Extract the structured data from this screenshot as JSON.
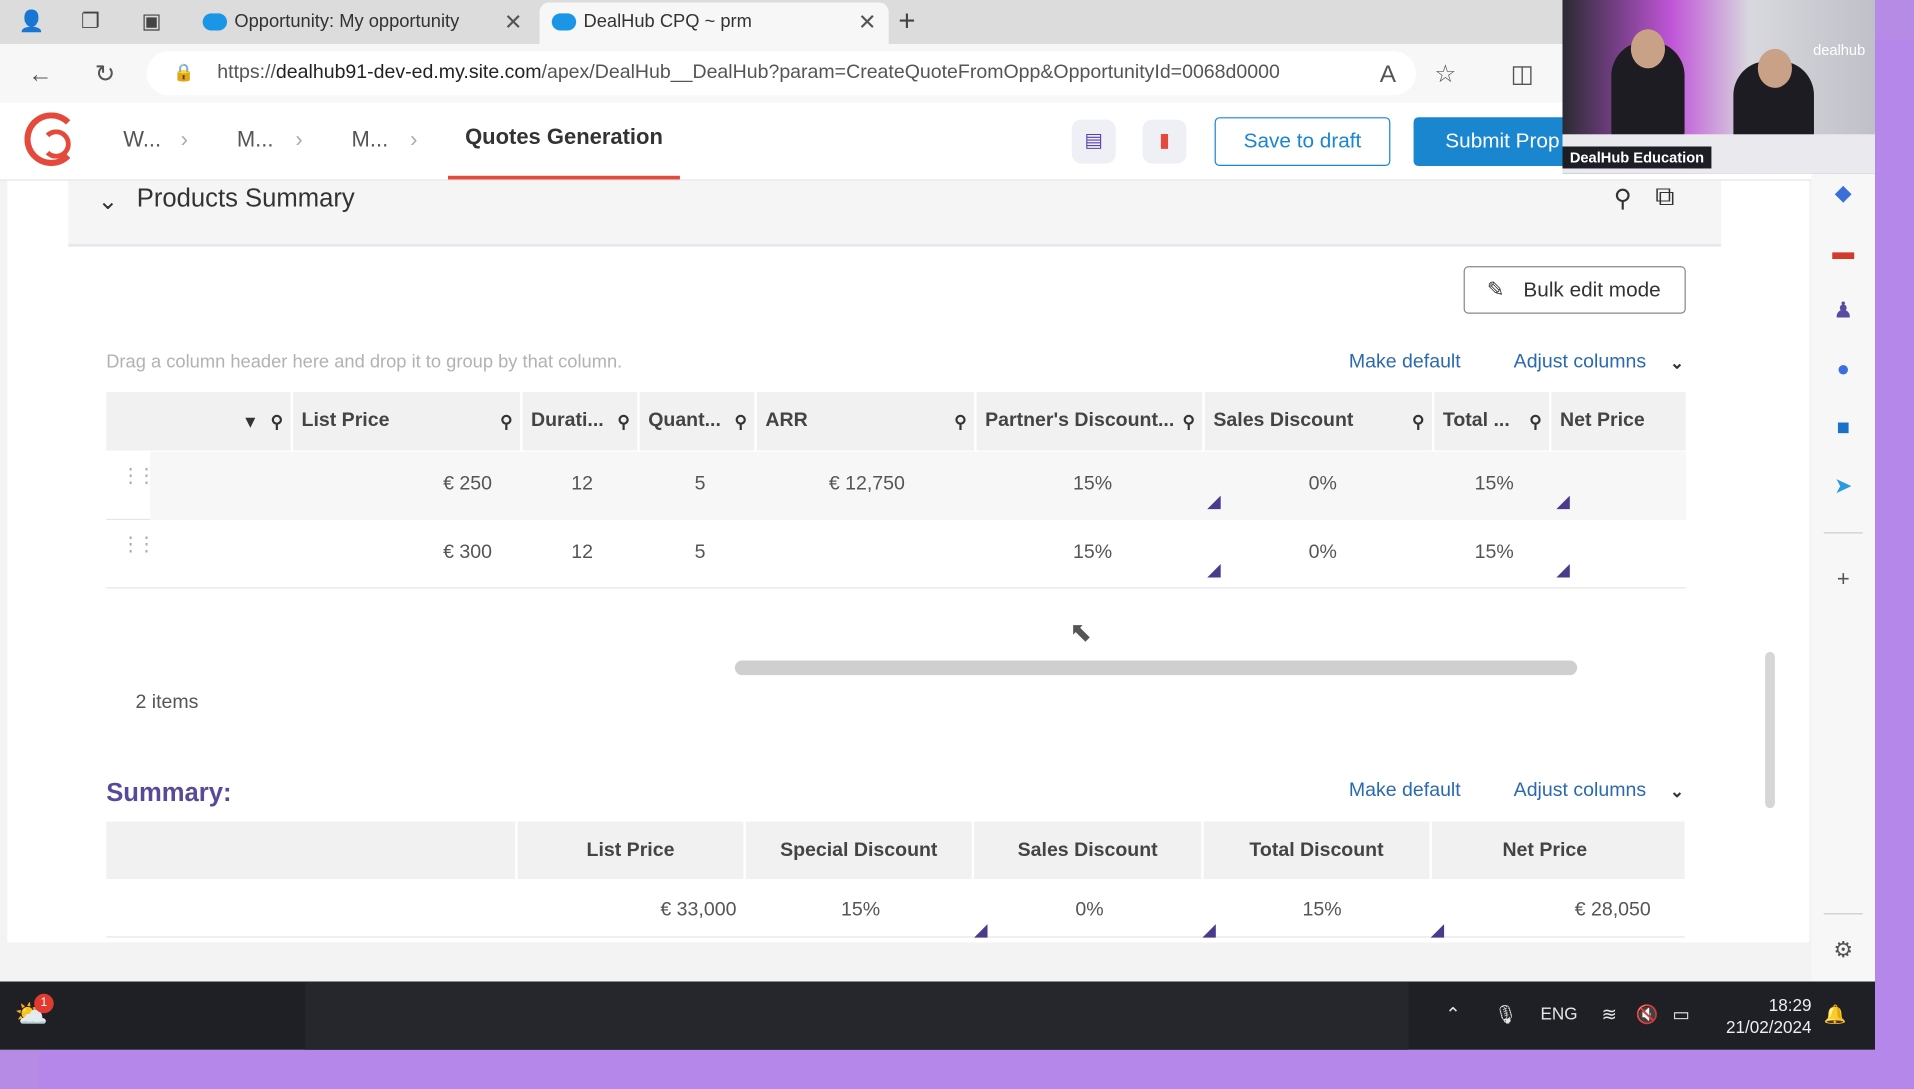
{
  "browser": {
    "tabs": [
      {
        "label": "Opportunity: My opportunity"
      },
      {
        "label": "DealHub CPQ ~ prm"
      }
    ],
    "url_prefix": "https://",
    "url_host": "dealhub91-dev-ed.my.site.com",
    "url_path": "/apex/DealHub__DealHub?param=CreateQuoteFromOpp&OpportunityId=0068d0000"
  },
  "header": {
    "breadcrumbs": [
      "W...",
      "M...",
      "M..."
    ],
    "active_crumb": "Quotes Generation",
    "save_label": "Save to draft",
    "submit_label": "Submit Prop",
    "accent": "#e5493c",
    "brand_blue": "#1a86d0"
  },
  "products": {
    "section_title": "Products Summary",
    "bulk_edit_label": "Bulk edit mode",
    "drag_hint": "Drag a column header here and drop it to group by that column.",
    "make_default": "Make default",
    "adjust_columns": "Adjust columns",
    "columns": [
      "List Price",
      "Durati...",
      "Quant...",
      "ARR",
      "Partner's Discount...",
      "Sales Discount",
      "Total ...",
      "Net Price"
    ],
    "rows": [
      {
        "list_price": "€ 250",
        "duration": "12",
        "quantity": "5",
        "arr": "€ 12,750",
        "partner_discount": "15%",
        "sales_discount": "0%",
        "total": "15%"
      },
      {
        "list_price": "€ 300",
        "duration": "12",
        "quantity": "5",
        "arr": "",
        "partner_discount": "15%",
        "sales_discount": "0%",
        "total": "15%"
      }
    ],
    "items_count": "2 items"
  },
  "summary": {
    "title": "Summary:",
    "make_default": "Make default",
    "adjust_columns": "Adjust columns",
    "columns": [
      "List Price",
      "Special Discount",
      "Sales Discount",
      "Total Discount",
      "Net Price"
    ],
    "row": {
      "list_price": "€ 33,000",
      "special_discount": "15%",
      "sales_discount": "0%",
      "total_discount": "15%",
      "net_price": "€ 28,050"
    }
  },
  "video": {
    "brand": "dealhub",
    "caption": "DealHub Education"
  },
  "taskbar": {
    "notification_count": "1",
    "language": "ENG",
    "time": "18:29",
    "date": "21/02/2024"
  }
}
